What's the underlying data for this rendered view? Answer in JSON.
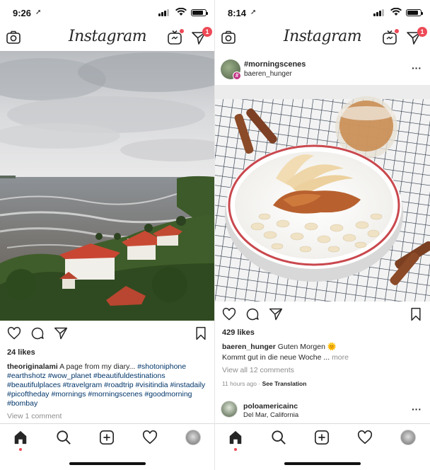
{
  "left": {
    "status": {
      "time": "9:26"
    },
    "nav": {
      "logo": "Instagram",
      "dm_badge": "1"
    },
    "post": {
      "likes": "24 likes",
      "username": "theoriginalami",
      "caption": "A page from my diary...",
      "hashtags": "#shotoniphone #earthshotz #wow_planet #beautifuldestinations #beautifulplaces #travelgram #roadtrip #visitindia #instadaily #picoftheday #mornings #morningscenes #goodmorning #bombay",
      "view_comments": "View 1 comment"
    }
  },
  "right": {
    "status": {
      "time": "8:14"
    },
    "nav": {
      "logo": "Instagram",
      "dm_badge": "1"
    },
    "post": {
      "title": "#morningscenes",
      "subtitle": "baeren_hunger",
      "hash_badge": "#",
      "likes": "429 likes",
      "username": "baeren_hunger",
      "caption_line1": "Guten Morgen 🌞",
      "caption_line2": "Kommt gut in die neue Woche ...",
      "more": "more",
      "view_comments": "View all 12 comments",
      "time_ago": "11 hours ago",
      "see_translation": "See Translation"
    },
    "next_post": {
      "username": "poloamericainc",
      "location": "Del Mar, California"
    }
  },
  "colors": {
    "notification": "#ed4956",
    "link": "#003569",
    "muted": "#8e8e8e"
  },
  "icons": [
    "camera-icon",
    "igtv-icon",
    "direct-message-icon",
    "heart-icon",
    "comment-icon",
    "share-icon",
    "bookmark-icon",
    "more-icon",
    "home-icon",
    "search-icon",
    "add-post-icon",
    "activity-icon",
    "profile-avatar"
  ]
}
